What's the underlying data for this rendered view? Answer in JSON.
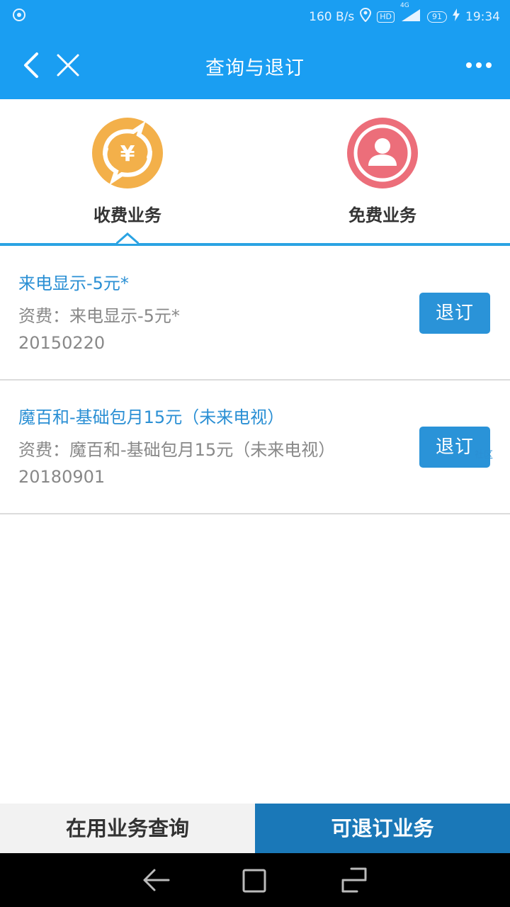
{
  "status_bar": {
    "speed": "160 B/s",
    "hd": "HD",
    "network": "4G",
    "battery": "91",
    "time": "19:34"
  },
  "title_bar": {
    "title": "查询与退订"
  },
  "tabs": {
    "paid": {
      "label": "收费业务",
      "color": "#f3b04a"
    },
    "free": {
      "label": "免费业务",
      "color": "#ec6e7a"
    }
  },
  "items": [
    {
      "name": "来电显示-5元*",
      "fee": "资费：来电显示-5元*",
      "date": "20150220",
      "action": "退订"
    },
    {
      "name": "魔百和-基础包月15元（未来电视）",
      "fee": "资费：魔百和-基础包月15元（未来电视）",
      "date": "20180901",
      "action": "退订"
    }
  ],
  "floating_badge": "社区",
  "bottom_tabs": {
    "in_use": "在用业务查询",
    "cancellable": "可退订业务"
  },
  "colors": {
    "header": "#1a9ef2",
    "accent": "#2a93d8",
    "active_tab": "#1a78b8"
  }
}
